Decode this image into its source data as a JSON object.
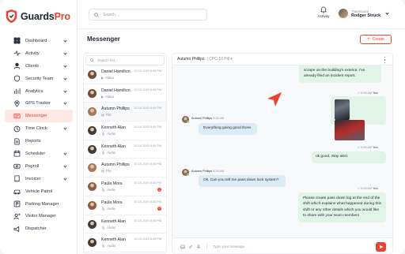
{
  "brand": {
    "name_a": "Guards",
    "name_b": "Pro"
  },
  "colors": {
    "accent": "#e8432e",
    "out_bubble": "#e2f3e8",
    "in_bubble": "#dcecf6"
  },
  "header": {
    "search_placeholder": "Search...",
    "activity_label": "Activity",
    "user_role": "TransGuard",
    "user_name": "Rodger Struck"
  },
  "sidebar": {
    "items": [
      {
        "label": "Dashboard",
        "icon": "dashboard-icon",
        "chevron": true
      },
      {
        "label": "Activity",
        "icon": "activity-icon",
        "chevron": true
      },
      {
        "label": "Clients",
        "icon": "clients-icon",
        "chevron": true
      },
      {
        "label": "Security Team",
        "icon": "security-team-icon",
        "chevron": true
      },
      {
        "label": "Analytics",
        "icon": "analytics-icon",
        "chevron": true
      },
      {
        "label": "GPS Tracker",
        "icon": "gps-icon",
        "chevron": true
      },
      {
        "label": "Messenger",
        "icon": "messenger-icon",
        "chevron": false,
        "active": true
      },
      {
        "label": "Time Clock",
        "icon": "clock-icon",
        "chevron": true
      },
      {
        "label": "Reports",
        "icon": "reports-icon",
        "chevron": false
      },
      {
        "label": "Scheduler",
        "icon": "scheduler-icon",
        "chevron": true
      },
      {
        "label": "Payroll",
        "icon": "payroll-icon",
        "chevron": true
      },
      {
        "label": "Invoicer",
        "icon": "invoicer-icon",
        "chevron": true
      },
      {
        "label": "Vehicle Patrol",
        "icon": "vehicle-icon",
        "chevron": false
      },
      {
        "label": "Parking Manager",
        "icon": "parking-icon",
        "chevron": false
      },
      {
        "label": "Visitor Manager",
        "icon": "visitor-icon",
        "chevron": false
      },
      {
        "label": "Dispatcher",
        "icon": "dispatcher-icon",
        "chevron": false
      }
    ]
  },
  "page": {
    "title": "Messenger",
    "create_label": "Create"
  },
  "conversations": {
    "search_placeholder": "Search list...",
    "items": [
      {
        "name": "Daniel Hamilton",
        "sub": "Video",
        "time": "10-10-2023 8:45 PM",
        "badge": ""
      },
      {
        "name": "Daniel Hamilton",
        "sub": "Video",
        "time": "10-10-2023 8:45 PM",
        "badge": ""
      },
      {
        "name": "Autumn Phillips",
        "sub": "File",
        "time": "10-10-2023 8:45 PM",
        "badge": ""
      },
      {
        "name": "Kenneth Alan",
        "sub": "Audio",
        "time": "10-10-2023 8:45 PM",
        "badge": ""
      },
      {
        "name": "Kenneth Alan",
        "sub": "Audio",
        "time": "10-10-2023 8:45 PM",
        "badge": ""
      },
      {
        "name": "Autumn Phillips",
        "sub": "File",
        "time": "10-10-2023 8:45 PM",
        "badge": ""
      },
      {
        "name": "Paula Mora",
        "sub": "Audio",
        "time": "10-10-2023 8:45 PM",
        "badge": "2"
      },
      {
        "name": "Paula Mora",
        "sub": "Audio",
        "time": "10-10-2023 8:45 PM",
        "badge": "2"
      },
      {
        "name": "Kenneth Alan",
        "sub": "Audio",
        "time": "10-10-2023 8:45 PM",
        "badge": ""
      },
      {
        "name": "Kenneth Alan",
        "sub": "Audio",
        "time": "10-10-2023 8:45 PM",
        "badge": ""
      }
    ]
  },
  "chat": {
    "contact_name": "Autumn Phillips",
    "contact_post": "CPC-10 Pill",
    "messages": {
      "m0_text": "scrape on the building's exterior. I've already filed an incident report.",
      "m1_time": "8:26 AM",
      "m1_sender": "You",
      "m2_sender": "Autumn Phillips",
      "m2_time": "8:26 AM",
      "m2_text": "Everything going good there.",
      "m3_time": "8:26 AM",
      "m3_sender": "You",
      "m3_text": "ok good. Stay alert.",
      "m4_sender": "Autumn Phillips",
      "m4_time": "8:26 AM",
      "m4_text": "Ok. Can you tell me pass down lock system?",
      "m5_time": "8:26 AM",
      "m5_sender": "You",
      "m5_text": "Please create pass down log at the end of the shift which explains what happened during this shift or any other details which you would like to share with your team members"
    },
    "input_placeholder": "Type your message..."
  }
}
